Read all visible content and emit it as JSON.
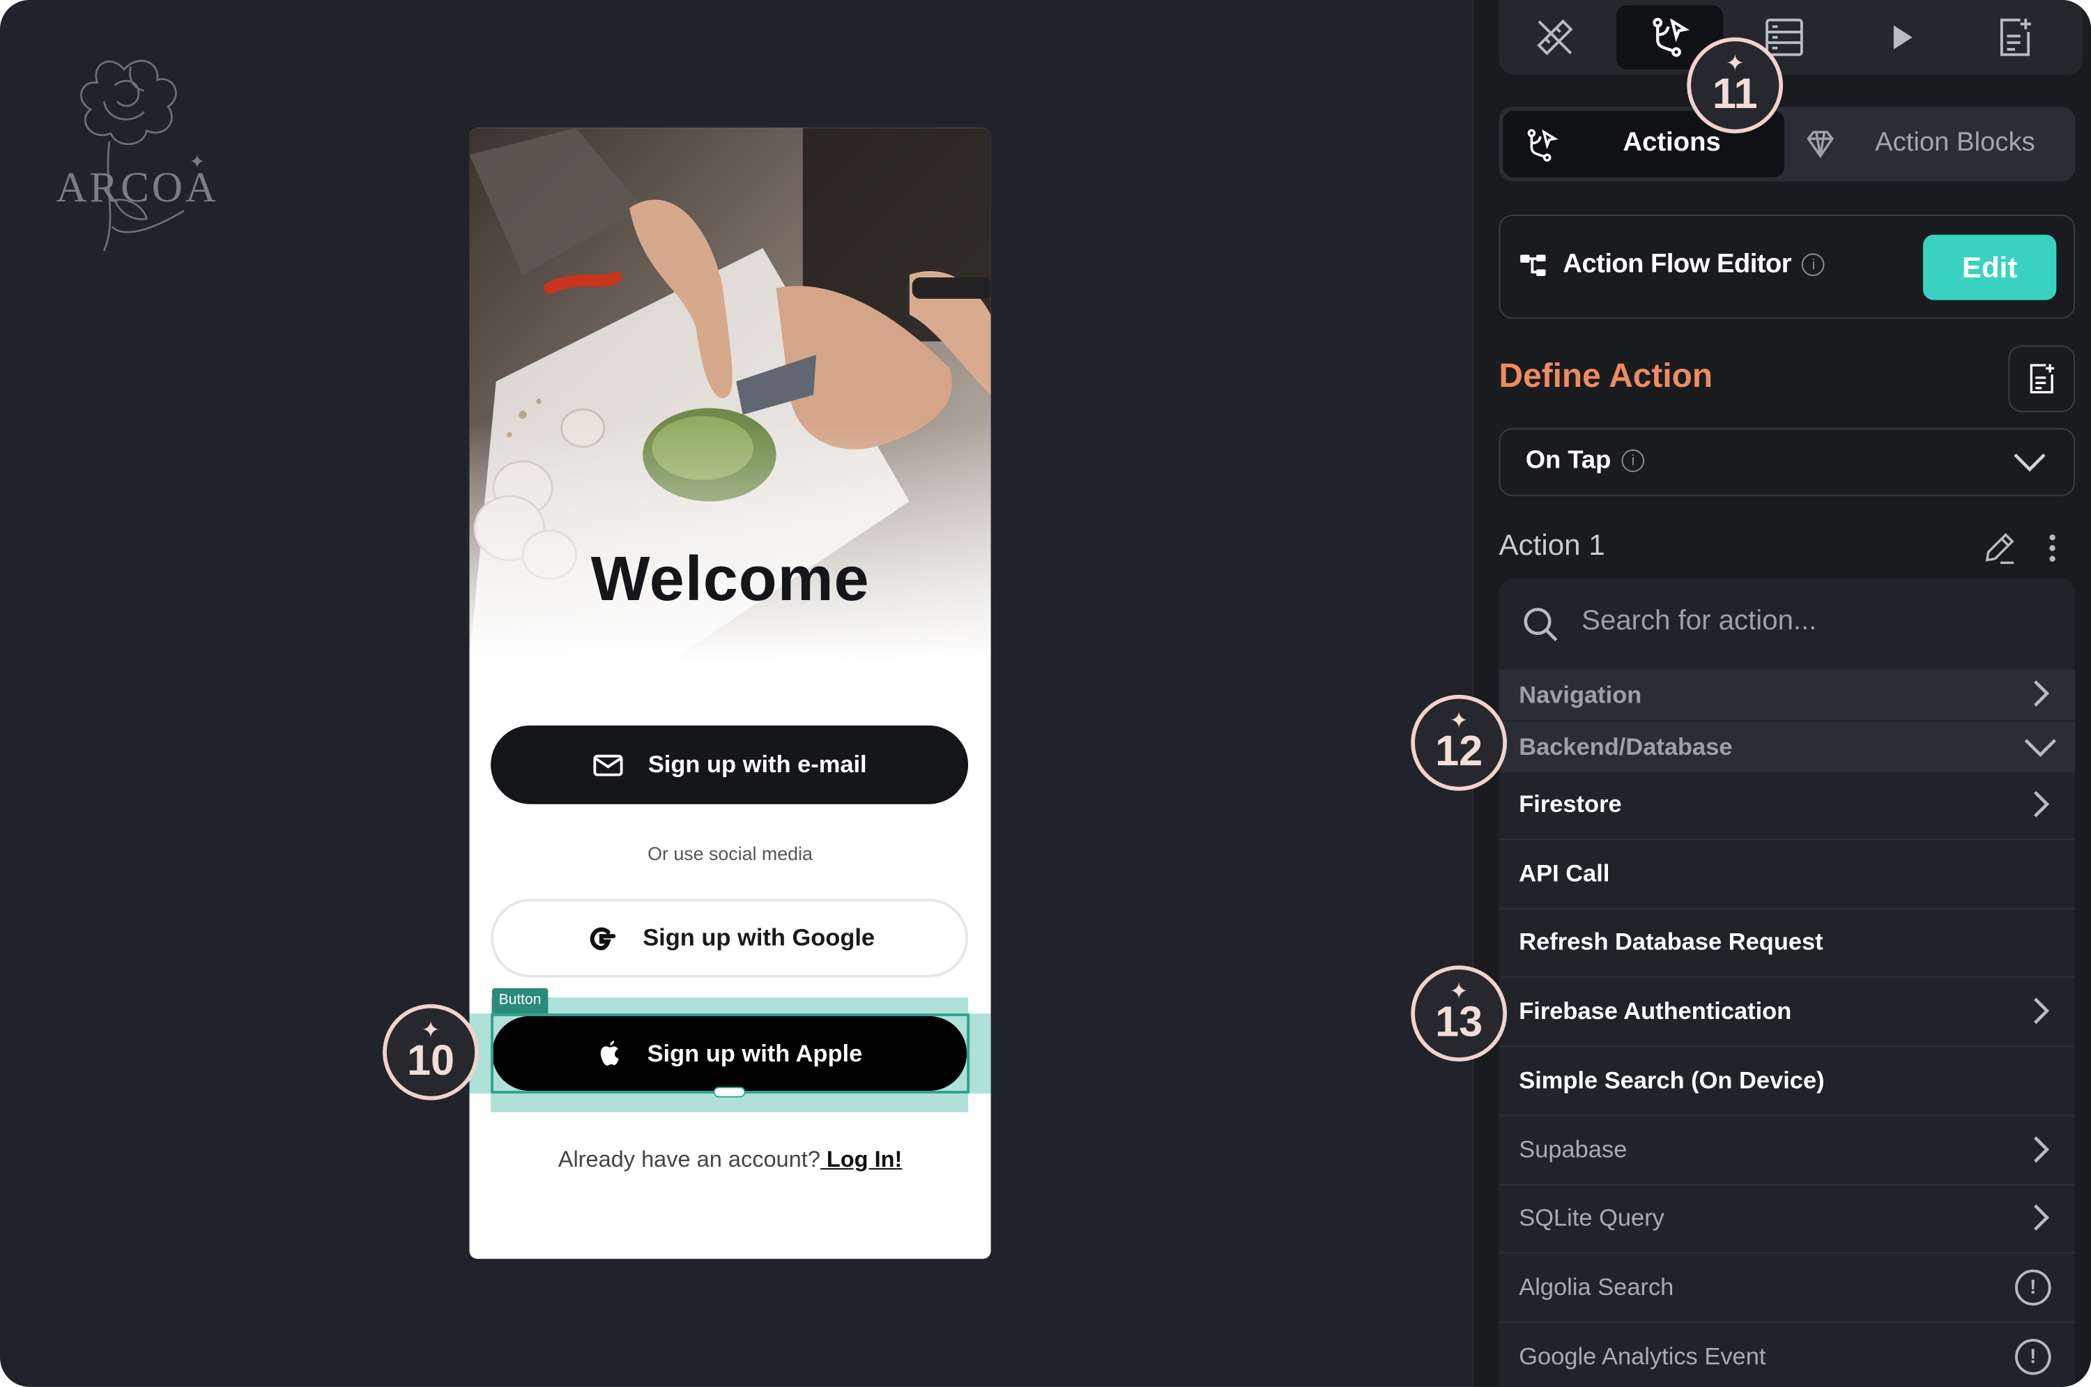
{
  "brand": {
    "logo_text": "ARCOA"
  },
  "phone": {
    "welcome": "Welcome",
    "email_button": "Sign up with e-mail",
    "or_text": "Or use social media",
    "google_button": "Sign up with Google",
    "apple_button": "Sign up with Apple",
    "selection_tag": "Button",
    "login_prompt": "Already have an account?",
    "login_link": " Log In!"
  },
  "callouts": {
    "c10": "10",
    "c11": "11",
    "c12": "12",
    "c13": "13"
  },
  "panel": {
    "tabs": {
      "actions": "Actions",
      "action_blocks": "Action Blocks"
    },
    "action_flow_editor": "Action Flow Editor",
    "edit_button": "Edit",
    "define_action": "Define Action",
    "trigger": "On Tap",
    "action_title": "Action 1",
    "search_placeholder": "Search for action...",
    "categories": {
      "navigation": "Navigation",
      "backend": "Backend/Database"
    },
    "items": [
      {
        "label": "Firestore",
        "chevron": true,
        "style": "bold"
      },
      {
        "label": "API Call",
        "chevron": false,
        "style": "bold"
      },
      {
        "label": "Refresh Database Request",
        "chevron": false,
        "style": "bold"
      },
      {
        "label": "Firebase Authentication",
        "chevron": true,
        "style": "bold"
      },
      {
        "label": "Simple Search (On Device)",
        "chevron": false,
        "style": "bold"
      },
      {
        "label": "Supabase",
        "chevron": true,
        "style": "dim"
      },
      {
        "label": "SQLite Query",
        "chevron": true,
        "style": "dim"
      },
      {
        "label": "Algolia Search",
        "warning": true,
        "style": "dim"
      },
      {
        "label": "Google Analytics Event",
        "warning": true,
        "style": "dim"
      }
    ],
    "warning_glyph": "!"
  },
  "colors": {
    "background": "#202329",
    "panel": "#191b1f",
    "accent_teal": "#39d2c0",
    "define_orange": "#ee8b60",
    "callout_ring": "#f1d2cd"
  }
}
